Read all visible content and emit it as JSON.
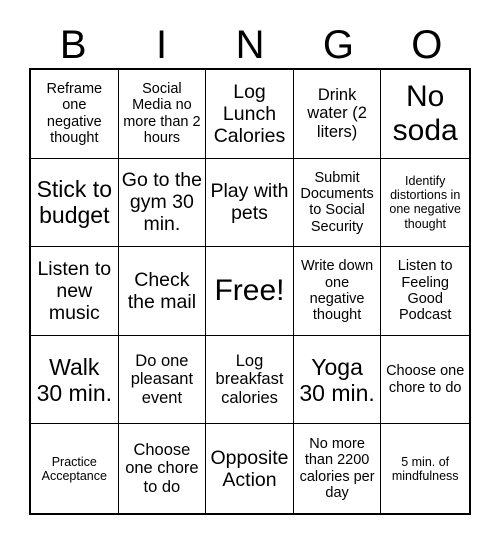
{
  "card": {
    "title_letters": [
      "B",
      "I",
      "N",
      "G",
      "O"
    ],
    "background_color": "#ffffff",
    "border_color": "#000000",
    "text_color": "#000000",
    "grid_size": "5x5",
    "free_space_label": "Free!"
  },
  "cells": [
    {
      "text": "Reframe one negative thought",
      "size": "s",
      "column": "B",
      "row": 1
    },
    {
      "text": "Social Media no more than 2 hours",
      "size": "s",
      "column": "I",
      "row": 1
    },
    {
      "text": "Log Lunch Calories",
      "size": "l",
      "column": "N",
      "row": 1
    },
    {
      "text": "Drink water (2 liters)",
      "size": "m",
      "column": "G",
      "row": 1
    },
    {
      "text": "No soda",
      "size": "xxl",
      "column": "O",
      "row": 1
    },
    {
      "text": "Stick to budget",
      "size": "xl",
      "column": "B",
      "row": 2
    },
    {
      "text": "Go to the gym 30 min.",
      "size": "l",
      "column": "I",
      "row": 2
    },
    {
      "text": "Play with pets",
      "size": "l",
      "column": "N",
      "row": 2
    },
    {
      "text": "Submit Documents to Social Security",
      "size": "s",
      "column": "G",
      "row": 2
    },
    {
      "text": "Identify distortions in one negative thought",
      "size": "xs",
      "column": "O",
      "row": 2
    },
    {
      "text": "Listen to new music",
      "size": "l",
      "column": "B",
      "row": 3
    },
    {
      "text": "Check the mail",
      "size": "l",
      "column": "I",
      "row": 3
    },
    {
      "text": "Free!",
      "size": "free",
      "column": "N",
      "row": 3
    },
    {
      "text": "Write down one negative thought",
      "size": "s",
      "column": "G",
      "row": 3
    },
    {
      "text": "Listen to Feeling Good Podcast",
      "size": "s",
      "column": "O",
      "row": 3
    },
    {
      "text": "Walk 30 min.",
      "size": "xl",
      "column": "B",
      "row": 4
    },
    {
      "text": "Do one pleasant event",
      "size": "m",
      "column": "I",
      "row": 4
    },
    {
      "text": "Log breakfast calories",
      "size": "m",
      "column": "N",
      "row": 4
    },
    {
      "text": "Yoga 30 min.",
      "size": "xl",
      "column": "G",
      "row": 4
    },
    {
      "text": "Choose one chore to do",
      "size": "s",
      "column": "O",
      "row": 4
    },
    {
      "text": "Practice Acceptance",
      "size": "xs",
      "column": "B",
      "row": 5
    },
    {
      "text": "Choose one chore to do",
      "size": "m",
      "column": "I",
      "row": 5
    },
    {
      "text": "Opposite Action",
      "size": "l",
      "column": "N",
      "row": 5
    },
    {
      "text": "No more than 2200 calories per day",
      "size": "s",
      "column": "G",
      "row": 5
    },
    {
      "text": "5 min. of mindfulness",
      "size": "xs",
      "column": "O",
      "row": 5
    }
  ]
}
